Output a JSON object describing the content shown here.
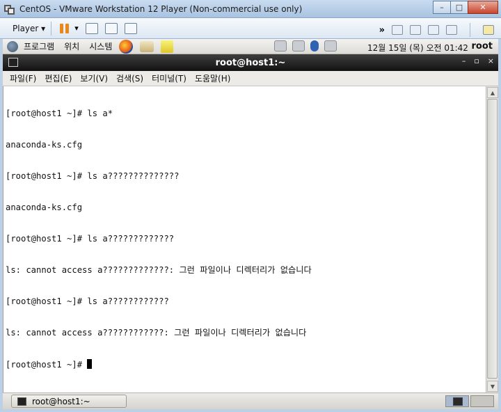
{
  "vm_window": {
    "title": "CentOS - VMware Workstation 12 Player (Non-commercial use only)",
    "controls": {
      "minimize": "–",
      "maximize": "□",
      "close": "✕"
    }
  },
  "vm_toolbar": {
    "player_menu": "Player ▾",
    "pause_dropdown": "▾",
    "forward": "»"
  },
  "gnome_panel": {
    "menus": [
      "프로그램",
      "위치",
      "시스템"
    ],
    "clock": "12월 15일 (목) 오전 01:42",
    "user": "root"
  },
  "terminal": {
    "title": "root@host1:~",
    "controls": {
      "minimize": "–",
      "maximize": "▫",
      "close": "×"
    },
    "menus": [
      "파일(F)",
      "편집(E)",
      "보기(V)",
      "검색(S)",
      "터미널(T)",
      "도움말(H)"
    ],
    "lines": [
      "[root@host1 ~]# ls a*",
      "anaconda-ks.cfg",
      "[root@host1 ~]# ls a??????????????",
      "anaconda-ks.cfg",
      "[root@host1 ~]# ls a?????????????",
      "ls: cannot access a?????????????: 그런 파일이나 디렉터리가 없습니다",
      "[root@host1 ~]# ls a????????????",
      "ls: cannot access a????????????: 그런 파일이나 디렉터리가 없습니다",
      "[root@host1 ~]# "
    ]
  },
  "taskbar": {
    "task_label": "root@host1:~"
  }
}
